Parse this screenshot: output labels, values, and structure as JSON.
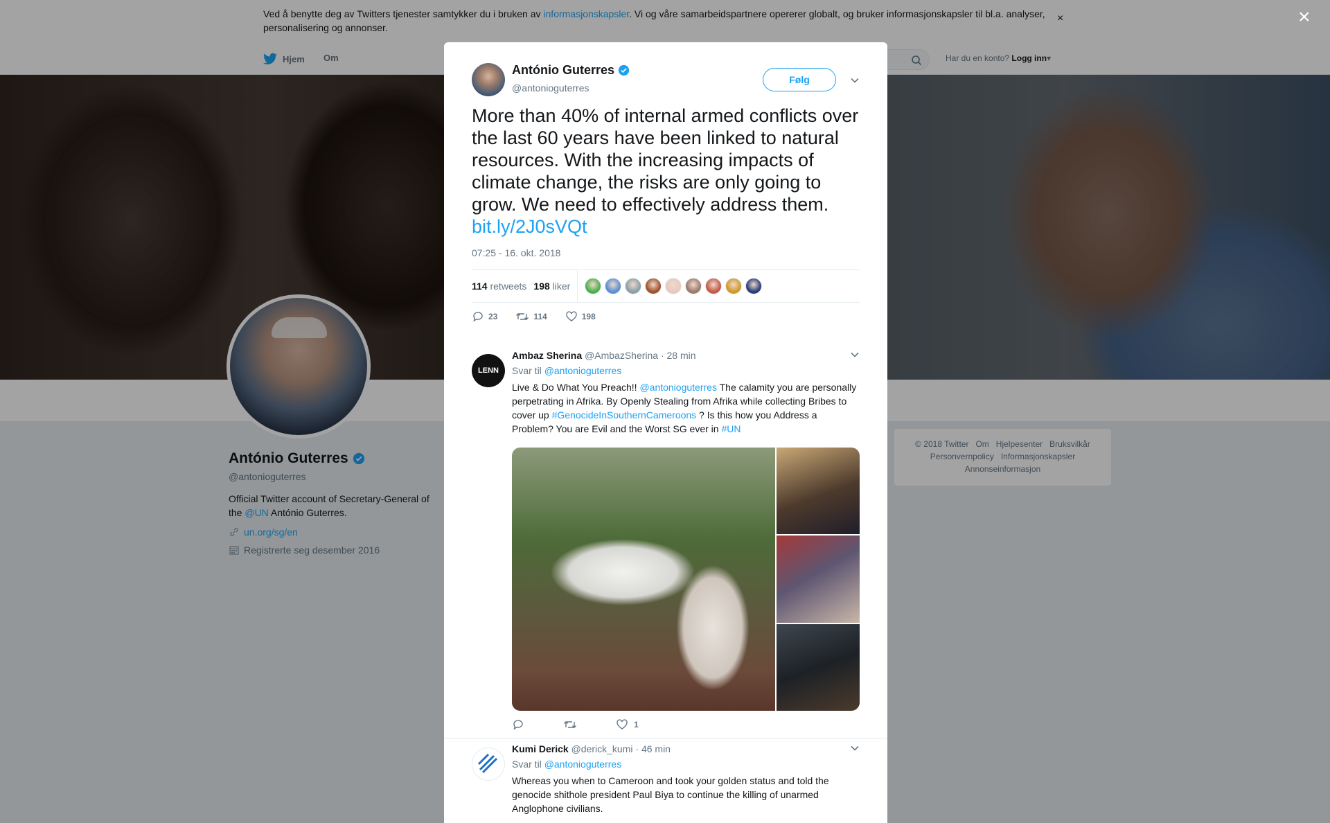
{
  "cookie": {
    "text_before": "Ved å benytte deg av Twitters tjenester samtykker du i bruken av ",
    "link": "informasjonskapsler",
    "text_after": ". Vi og våre samarbeidspartnere opererer globalt, og bruker informasjonskapsler til bl.a. analyser, personalisering og annonser.",
    "close": "×"
  },
  "nav": {
    "home": "Hjem",
    "about": "Om",
    "login_prompt": "Har du en konto?",
    "login": "Logg inn"
  },
  "profile": {
    "name": "António Guterres",
    "handle": "@antonioguterres",
    "bio_before": "Official Twitter account of Secretary-General of the ",
    "bio_link": "@UN",
    "bio_after": " António Guterres.",
    "website": "un.org/sg/en",
    "joined": "Registrerte seg desember 2016"
  },
  "footer": {
    "links": [
      "© 2018 Twitter",
      "Om",
      "Hjelpesenter",
      "Bruksvilkår",
      "Personvernpolicy",
      "Informasjonskapsler",
      "Annonseinformasjon"
    ]
  },
  "modal": {
    "close": "×",
    "author_name": "António Guterres",
    "author_handle": "@antonioguterres",
    "follow": "Følg",
    "text": "More than 40% of internal armed conflicts over the last 60 years have been linked to natural resources. With the increasing impacts of climate change, the risks are only going to grow. We need to effectively address them.",
    "link": "bit.ly/2J0sVQt",
    "time": "07:25 - 16. okt. 2018",
    "retweets_count": "114",
    "retweets_label": "retweets",
    "likes_count": "198",
    "likes_label": "liker",
    "likers": [
      "#4caf50",
      "#5b8fd6",
      "#8aa0a8",
      "#a0522d",
      "#e8c9c0",
      "#9b7b6e",
      "#c25b4a",
      "#d09a2a",
      "#2a3f7a"
    ],
    "actions": {
      "replies": "23",
      "retweets": "114",
      "likes": "198"
    }
  },
  "replies": [
    {
      "name": "Ambaz Sherina",
      "handle": "@AmbazSherina",
      "time": "· 28 min",
      "reply_label": "Svar til",
      "reply_to": "@antonioguterres",
      "text_1": "Live & Do What You Preach!! ",
      "mention": "@antonioguterres",
      "text_2": " The calamity you are personally perpetrating in Afrika.  By Openly Stealing from Afrika while collecting Bribes  to cover up ",
      "hashtag_1": "#GenocideInSouthernCameroons",
      "text_3": " ? Is this how you Address a Problem? You are Evil and the Worst SG ever in ",
      "hashtag_2": "#UN",
      "avatar_text": "LENN",
      "likes": "1"
    },
    {
      "name": "Kumi Derick",
      "handle": "@derick_kumi",
      "time": "· 46 min",
      "reply_label": "Svar til",
      "reply_to": "@antonioguterres",
      "text": "Whereas you when to Cameroon and took your golden status and told the genocide shithole president Paul Biya to continue the killing of unarmed Anglophone civilians."
    }
  ],
  "colors": {
    "accent": "#1da1f2",
    "text": "#14171a",
    "muted": "#657786",
    "bg": "#e6ecf0"
  }
}
